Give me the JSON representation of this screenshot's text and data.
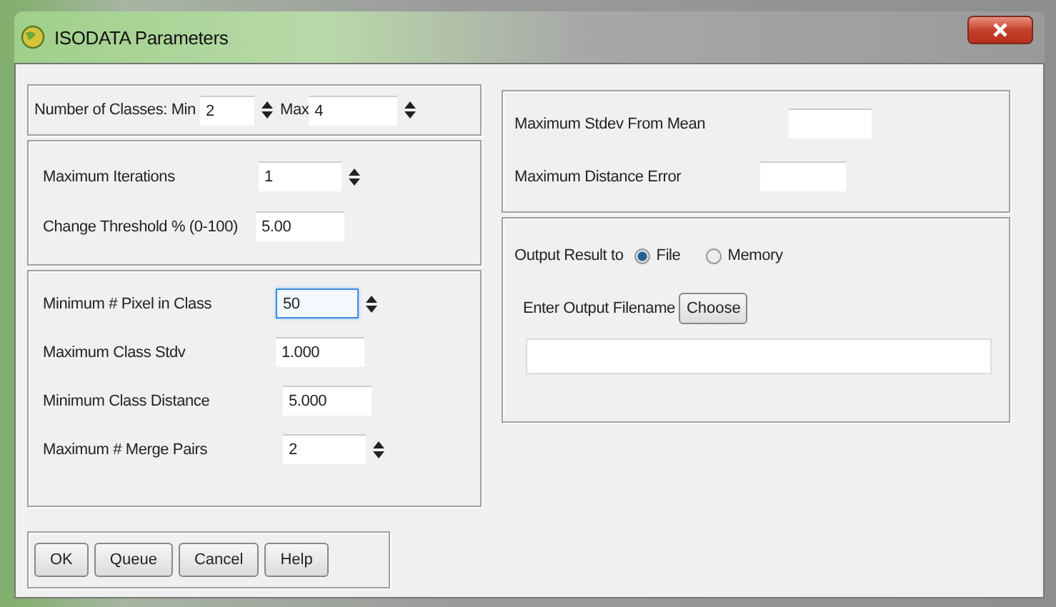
{
  "window": {
    "title": "ISODATA Parameters"
  },
  "number_of_classes": {
    "label": "Number of Classes: Min",
    "min": "2",
    "max_label": "Max",
    "max": "4"
  },
  "iteration_group": [
    {
      "kind": "spin",
      "label": "Maximum Iterations",
      "value": "1"
    },
    {
      "kind": "text",
      "label": "Change Threshold % (0-100)",
      "value": "5.00"
    }
  ],
  "class_group": [
    {
      "kind": "spin",
      "label": "Minimum # Pixel in Class",
      "value": "50",
      "focused": true
    },
    {
      "kind": "text",
      "label": "Maximum Class Stdv",
      "value": "1.000",
      "focused": false
    },
    {
      "kind": "text",
      "label": "Minimum Class Distance",
      "value": "5.000",
      "focused": false
    },
    {
      "kind": "spin",
      "label": "Maximum # Merge Pairs",
      "value": "2",
      "focused": false
    }
  ],
  "buttons": [
    "OK",
    "Queue",
    "Cancel",
    "Help"
  ],
  "stdev_group": [
    {
      "label": "Maximum Stdev From Mean"
    },
    {
      "label": "Maximum Distance Error"
    }
  ],
  "output": {
    "label": "Output Result to",
    "options": [
      {
        "label": "File",
        "selected": true
      },
      {
        "label": "Memory",
        "selected": false
      }
    ],
    "filename_label": "Enter Output Filename",
    "choose_button": "Choose"
  }
}
